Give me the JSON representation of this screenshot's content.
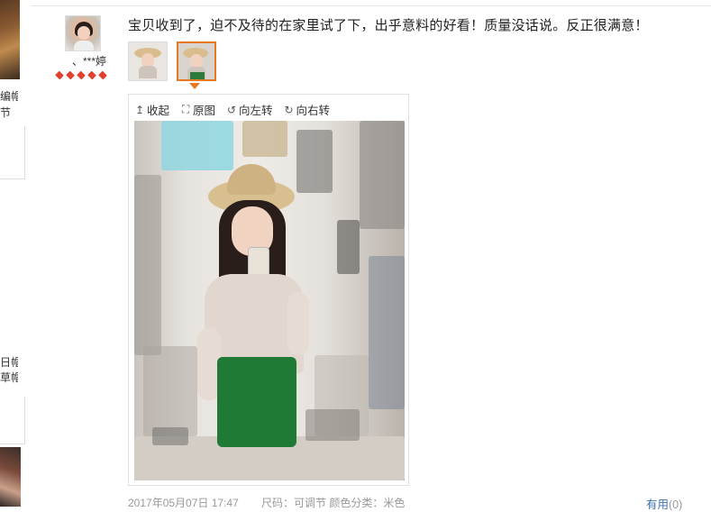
{
  "left_strip": {
    "snippets": [
      "编帽",
      "节",
      "日帽",
      "草帽"
    ]
  },
  "reviewer": {
    "username": "、***婷",
    "rank_icon": "red-heart-diamond",
    "rank_count": 5
  },
  "review": {
    "text": "宝贝收到了，迫不及待的在家里试了下，出乎意料的好看！质量没话说。反正很满意！",
    "date": "2017年05月07日 17:47",
    "attributes": "尺码：可调节  颜色分类：米色"
  },
  "viewer": {
    "toolbar": {
      "collapse": "收起",
      "original": "原图",
      "rotate_left": "向左转",
      "rotate_right": "向右转"
    },
    "collapse_icon": "arrow-up-icon",
    "original_icon": "expand-icon",
    "rotate_left_icon": "rotate-left-icon",
    "rotate_right_icon": "rotate-right-icon"
  },
  "actions": {
    "useful_label": "有用",
    "useful_count": "(0)"
  },
  "colors": {
    "accent_orange": "#e67a22",
    "link_blue": "#3a6fb0",
    "rank_red": "#e2402f",
    "muted_gray": "#999999"
  }
}
